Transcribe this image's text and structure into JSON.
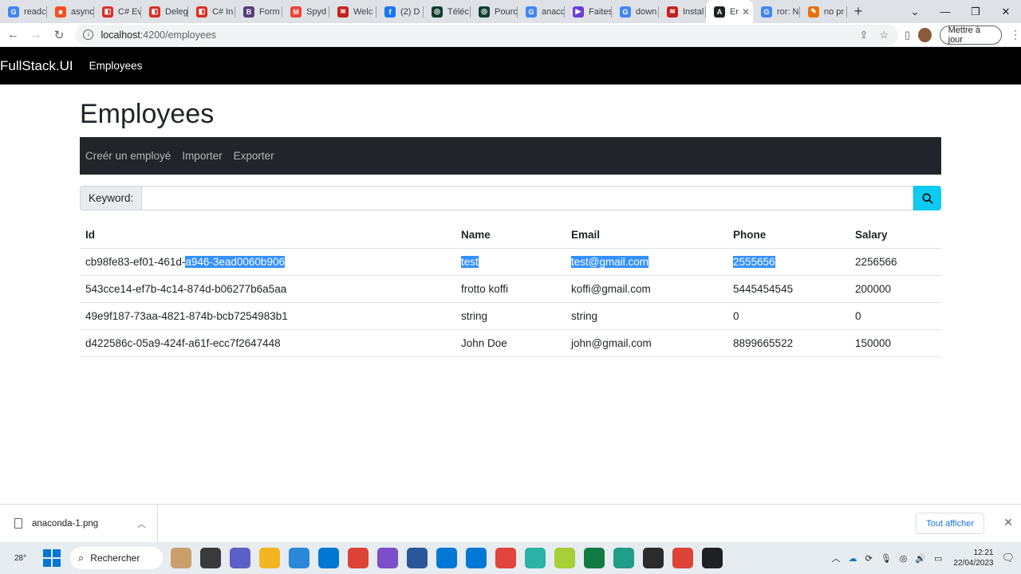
{
  "browser": {
    "tabs": [
      {
        "label": "readc",
        "color": "#4285f4",
        "glyph": "G"
      },
      {
        "label": "async",
        "color": "#f25022",
        "glyph": "■"
      },
      {
        "label": "C# Ev",
        "color": "#d93025",
        "glyph": "◧"
      },
      {
        "label": "Deleg",
        "color": "#d93025",
        "glyph": "◧"
      },
      {
        "label": "C# In",
        "color": "#d93025",
        "glyph": "◧"
      },
      {
        "label": "Form",
        "color": "#563d7c",
        "glyph": "B"
      },
      {
        "label": "Spyd",
        "color": "#ea4335",
        "glyph": "M"
      },
      {
        "label": "Welc",
        "color": "#c5221f",
        "glyph": "≋"
      },
      {
        "label": "(2) D",
        "color": "#1877f2",
        "glyph": "f"
      },
      {
        "label": "Téléc",
        "color": "#0f3d2e",
        "glyph": "◎"
      },
      {
        "label": "Pourc",
        "color": "#0f3d2e",
        "glyph": "◎"
      },
      {
        "label": "anacc",
        "color": "#4285f4",
        "glyph": "G"
      },
      {
        "label": "Faites",
        "color": "#6b3fd4",
        "glyph": "▶"
      },
      {
        "label": "down",
        "color": "#4285f4",
        "glyph": "G"
      },
      {
        "label": "Instal",
        "color": "#c5221f",
        "glyph": "≋"
      },
      {
        "label": "Er",
        "color": "#202124",
        "glyph": "A",
        "active": true
      },
      {
        "label": "ror: N",
        "color": "#4285f4",
        "glyph": "G"
      },
      {
        "label": "no pr",
        "color": "#e8710a",
        "glyph": "✎"
      }
    ],
    "active_close": "✕",
    "new_tab": "+",
    "window_controls": [
      "⌄",
      "—",
      "❐",
      "✕"
    ],
    "url_host": "localhost",
    "url_path": ":4200/employees",
    "update_button": "Mettre à jour"
  },
  "app": {
    "brand": "FullStack.UI",
    "nav_link": "Employees",
    "page_title": "Employees",
    "actions": [
      "Creér un employé",
      "Importer",
      "Exporter"
    ],
    "search_label": "Keyword:",
    "search_value": "",
    "table": {
      "headers": [
        "Id",
        "Name",
        "Email",
        "Phone",
        "Salary"
      ],
      "rows": [
        {
          "id_a": "cb98fe83-ef01-461d-",
          "id_b": "a946-3ead0060b906",
          "name": "test",
          "email": "test@gmail.com",
          "phone": "2555656",
          "salary": "2256566",
          "selected": true
        },
        {
          "id_a": "543cce14-ef7b-4c14-874d-b06277b6a5aa",
          "id_b": "",
          "name": "frotto koffi",
          "email": "koffi@gmail.com",
          "phone": "5445454545",
          "salary": "200000"
        },
        {
          "id_a": "49e9f187-73aa-4821-874b-bcb7254983b1",
          "id_b": "",
          "name": "string",
          "email": "string",
          "phone": "0",
          "salary": "0"
        },
        {
          "id_a": "d422586c-05a9-424f-a61f-ecc7f2647448",
          "id_b": "",
          "name": "John Doe",
          "email": "john@gmail.com",
          "phone": "8899665522",
          "salary": "150000"
        }
      ]
    }
  },
  "download_bar": {
    "file": "anaconda-1.png",
    "show_all": "Tout afficher"
  },
  "taskbar": {
    "weather": "28°",
    "search": "Rechercher",
    "time": "12:21",
    "date": "22/04/2023",
    "app_colors": [
      "#c9a06b",
      "#3a3a3a",
      "#5b5fc7",
      "#f3b623",
      "#2b88d8",
      "#0078d4",
      "#db4437",
      "#7a4fc9",
      "#2b579a",
      "#0078d4",
      "#0078d4",
      "#e0443a",
      "#2ab3a6",
      "#a6cf38",
      "#107c41",
      "#1f9e89",
      "#2b2b2b",
      "#db4437",
      "#202124"
    ]
  },
  "colors": {
    "accent_search": "#0dcaf0",
    "navbar_bg": "#000000",
    "subnav_bg": "#212529",
    "selection": "#3390ff"
  }
}
